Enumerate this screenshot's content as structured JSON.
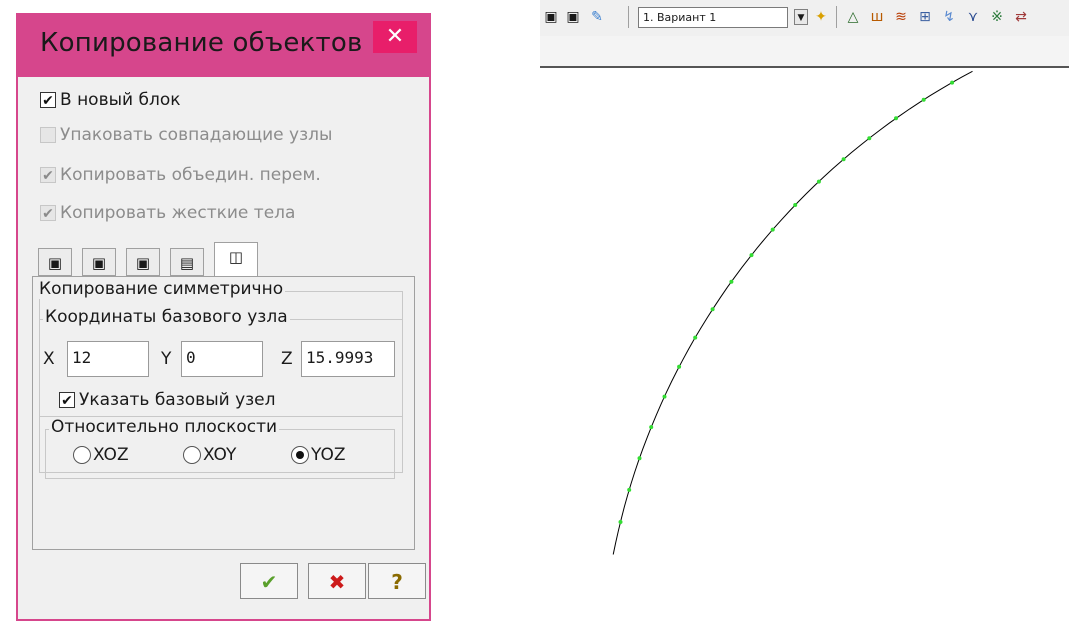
{
  "dialog": {
    "title": "Копирование объектов",
    "close_label": "✕",
    "options": [
      {
        "label": "В новый блок",
        "checked": true,
        "enabled": true
      },
      {
        "label": "Упаковать совпадающие узлы",
        "checked": false,
        "enabled": false
      },
      {
        "label": "Копировать объедин. перем.",
        "checked": true,
        "enabled": false
      },
      {
        "label": "Копировать жесткие тела",
        "checked": true,
        "enabled": false
      }
    ],
    "tabs": [
      "tab-copy-1-icon",
      "tab-copy-2-icon",
      "tab-copy-3-icon",
      "tab-copy-4-icon",
      "tab-symmetric-icon"
    ],
    "panel": {
      "group_title": "Копирование симметрично",
      "base_node_title": "Координаты базового узла",
      "x_label": "X",
      "x_value": "12",
      "y_label": "Y",
      "y_value": "0",
      "z_label": "Z",
      "z_value": "15.9993",
      "pick_base_label": "Указать базовый узел",
      "pick_base_checked": true,
      "plane_title": "Относительно плоскости",
      "planes": [
        "XOZ",
        "XOY",
        "YOZ"
      ],
      "selected_plane": "YOZ"
    },
    "buttons": {
      "ok": "✔",
      "cancel": "✖",
      "help": "?"
    }
  },
  "toolbar": {
    "variant": "1. Вариант 1"
  },
  "colors": {
    "titlebar": "#d6468c",
    "close": "#e81e6a",
    "node": "#33dd33"
  }
}
